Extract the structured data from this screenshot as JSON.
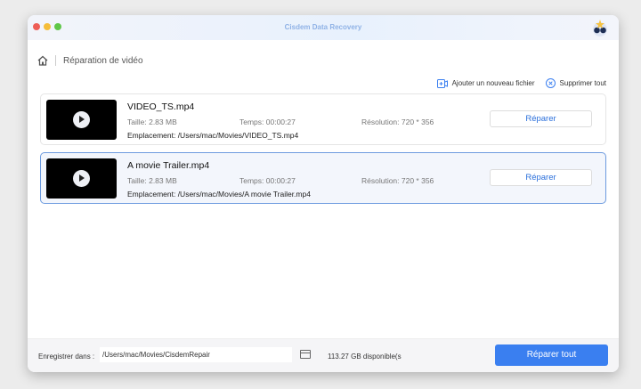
{
  "window": {
    "title": "Cisdem Data Recovery"
  },
  "breadcrumb": {
    "label": "Réparation de vidéo"
  },
  "actions": {
    "add": "Ajouter un nouveau fichier",
    "remove_all": "Supprimer tout"
  },
  "files": [
    {
      "name": "VIDEO_TS.mp4",
      "size": "Taille: 2.83 MB",
      "time": "Temps: 00:00:27",
      "resolution": "Résolution: 720 * 356",
      "location": "Emplacement: /Users/mac/Movies/VIDEO_TS.mp4",
      "button": "Réparer"
    },
    {
      "name": "A movie Trailer.mp4",
      "size": "Taille: 2.83 MB",
      "time": "Temps: 00:00:27",
      "resolution": "Résolution: 720 * 356",
      "location": "Emplacement: /Users/mac/Movies/A movie Trailer.mp4",
      "button": "Réparer"
    }
  ],
  "footer": {
    "save_label": "Enregistrer dans :",
    "save_path": "/Users/mac/Movies/CisdemRepair",
    "space": "113.27 GB disponible(s",
    "repair_all": "Réparer tout"
  }
}
